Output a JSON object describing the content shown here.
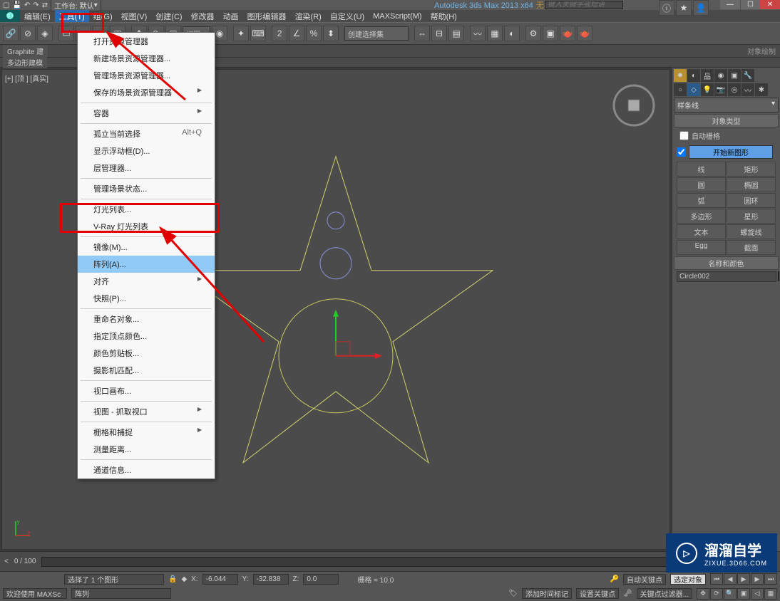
{
  "window": {
    "app_title": "Autodesk 3ds Max  2013 x64",
    "doc_title": "无标题",
    "search_placeholder": "键入关键字或短语",
    "workspace_label": "工作台: 默认"
  },
  "menubar": {
    "items": [
      "编辑(E)",
      "工具(T)",
      "组(G)",
      "视图(V)",
      "创建(C)",
      "修改器",
      "动画",
      "图形编辑器",
      "渲染(R)",
      "自定义(U)",
      "MAXScript(M)",
      "帮助(H)"
    ],
    "active_index": 1
  },
  "toolbar": {
    "view_combo": "视图",
    "selset_combo": "创建选择集"
  },
  "ribbon": {
    "tab1": "Graphite 建",
    "tab2": "多边形建模",
    "panel_label": "对象绘制"
  },
  "viewport": {
    "label": "[+] [顶 ] [真实]"
  },
  "tools_menu": {
    "items": [
      {
        "label": "打开资源管理器",
        "type": "item"
      },
      {
        "label": "新建场景资源管理器...",
        "type": "item"
      },
      {
        "label": "管理场景资源管理器...",
        "type": "item"
      },
      {
        "label": "保存的场景资源管理器",
        "type": "sub"
      },
      {
        "type": "sep"
      },
      {
        "label": "容器",
        "type": "sub"
      },
      {
        "type": "sep"
      },
      {
        "label": "孤立当前选择",
        "shortcut": "Alt+Q",
        "type": "item"
      },
      {
        "label": "显示浮动框(D)...",
        "type": "item"
      },
      {
        "label": "层管理器...",
        "type": "item"
      },
      {
        "type": "sep"
      },
      {
        "label": "管理场景状态...",
        "type": "item"
      },
      {
        "type": "sep"
      },
      {
        "label": "灯光列表...",
        "type": "item"
      },
      {
        "label": "V-Ray 灯光列表",
        "type": "item"
      },
      {
        "type": "sep"
      },
      {
        "label": "镜像(M)...",
        "type": "item"
      },
      {
        "label": "阵列(A)...",
        "type": "item",
        "highlighted": true
      },
      {
        "label": "对齐",
        "type": "sub"
      },
      {
        "label": "快照(P)...",
        "type": "item"
      },
      {
        "type": "sep"
      },
      {
        "label": "重命名对象...",
        "type": "item"
      },
      {
        "label": "指定顶点颜色...",
        "type": "item"
      },
      {
        "label": "颜色剪贴板...",
        "type": "item"
      },
      {
        "label": "摄影机匹配...",
        "type": "item"
      },
      {
        "type": "sep"
      },
      {
        "label": "视口画布...",
        "type": "item"
      },
      {
        "type": "sep"
      },
      {
        "label": "视图 - 抓取视口",
        "type": "sub"
      },
      {
        "type": "sep"
      },
      {
        "label": "栅格和捕捉",
        "type": "sub"
      },
      {
        "label": "测量距离...",
        "type": "item"
      },
      {
        "type": "sep"
      },
      {
        "label": "通道信息...",
        "type": "item"
      }
    ]
  },
  "right_panel": {
    "dropdown": "样条线",
    "rollout_type": "对象类型",
    "auto_grid": "自动栅格",
    "start_shape": "开始新图形",
    "shapes": [
      "线",
      "矩形",
      "圆",
      "椭圆",
      "弧",
      "圆环",
      "多边形",
      "星形",
      "文本",
      "螺旋线",
      "Egg",
      "截面"
    ],
    "rollout_name": "名称和颜色",
    "object_name": "Circle002"
  },
  "timeline": {
    "frame_label": "0 / 100"
  },
  "status": {
    "selection_info": "选择了 1 个图形",
    "mode": "阵列",
    "x": "-6.044",
    "y": "-32.838",
    "z": "0.0",
    "grid": "栅格 = 10.0",
    "add_time_tag": "添加时间标记",
    "autokey": "自动关键点",
    "setkey": "设置关键点",
    "sel_obj": "选定对象",
    "key_filter": "关键点过滤器...",
    "welcome": "欢迎使用  MAXSc",
    "x_label": "X:",
    "y_label": "Y:",
    "z_label": "Z:"
  },
  "watermark": {
    "main": "溜溜自学",
    "sub": "ZIXUE.3D66.COM"
  }
}
